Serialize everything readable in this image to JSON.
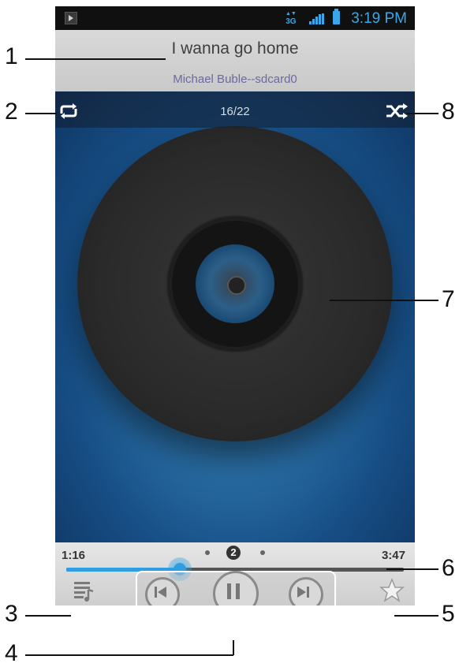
{
  "status_bar": {
    "network": "3G",
    "time": "3:19 PM"
  },
  "now_playing": {
    "title": "I wanna go home",
    "artist_source": "Michael Buble--sdcard0",
    "track_position": "16/22"
  },
  "playback": {
    "current_time": "1:16",
    "total_time": "3:47",
    "progress_fraction": 0.337,
    "page_indicator": "2"
  },
  "icons": {
    "repeat": "repeat-icon",
    "shuffle": "shuffle-icon",
    "playlist": "playlist-icon",
    "previous": "previous-icon",
    "pause": "pause-icon",
    "next": "next-icon",
    "favorite": "star-icon"
  },
  "callouts": [
    "1",
    "2",
    "3",
    "4",
    "5",
    "6",
    "7",
    "8"
  ],
  "colors": {
    "accent": "#2f9ee0",
    "status_text": "#3aa7e8"
  }
}
